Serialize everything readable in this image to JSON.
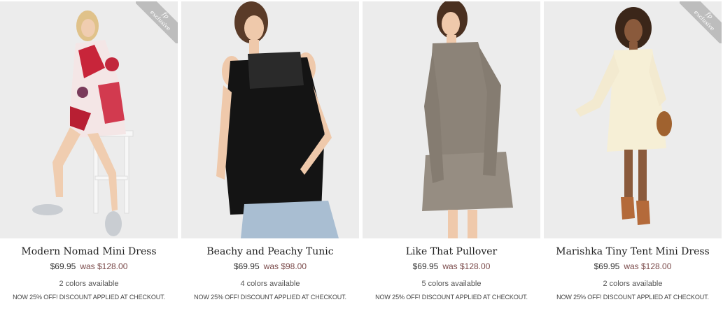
{
  "products": [
    {
      "name": "Modern Nomad Mini Dress",
      "price": "$69.95",
      "was_price": "was $128.00",
      "colors": "2 colors available",
      "promo": "NOW 25% OFF! DISCOUNT APPLIED AT CHECKOUT.",
      "badge": {
        "brand": "fp",
        "label": "exclusive"
      }
    },
    {
      "name": "Beachy and Peachy Tunic",
      "price": "$69.95",
      "was_price": "was $98.00",
      "colors": "4 colors available",
      "promo": "NOW 25% OFF! DISCOUNT APPLIED AT CHECKOUT."
    },
    {
      "name": "Like That Pullover",
      "price": "$69.95",
      "was_price": "was $128.00",
      "colors": "5 colors available",
      "promo": "NOW 25% OFF! DISCOUNT APPLIED AT CHECKOUT."
    },
    {
      "name": "Marishka Tiny Tent Mini Dress",
      "price": "$69.95",
      "was_price": "was $128.00",
      "colors": "2 colors available",
      "promo": "NOW 25% OFF! DISCOUNT APPLIED AT CHECKOUT.",
      "badge": {
        "brand": "fp",
        "label": "exclusive"
      }
    }
  ]
}
